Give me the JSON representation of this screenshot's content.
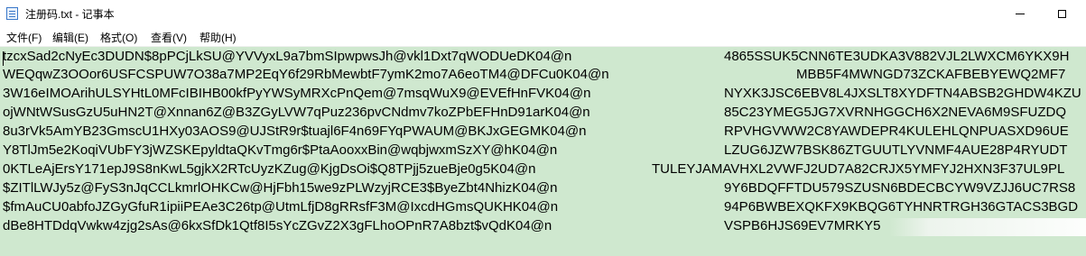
{
  "window": {
    "title": "注册码.txt - 记事本",
    "icon": "notepad-icon"
  },
  "menu": {
    "items": [
      {
        "label": "文件(F)"
      },
      {
        "label": "编辑(E)"
      },
      {
        "label": "格式(O)"
      },
      {
        "label": "查看(V)"
      },
      {
        "label": "帮助(H)"
      }
    ]
  },
  "editor": {
    "background": "#cfe8cf",
    "lines": [
      {
        "left": "tzcxSad2cNyEc3DUDN$8pPCjLkSU@YVVyxL9a7bmSIpwpwsJh@vkl1Dxt7qWODUeDK04@n",
        "right": "4865SSUK5CNN6TE3UDKA3V882VJL2LWXCM6YKX9H"
      },
      {
        "left": "WEQqwZ3OOor6USFCSPUW7O38a7MP2EqY6f29RbMewbtF7ymK2mo7A6eoTM4@DFCu0K04@n",
        "right": "MBB5F4MWNGD73ZCKAFBEBYEWQ2MF7"
      },
      {
        "left": "3W16eIMOArihULSYHtL0MFcIBIHB00kfPyYWSyMRXcPnQem@7msqWuX9@EVEfHnFVK04@n",
        "right": "NYXK3JSC6EBV8L4JXSLT8XYDFTN4ABSB2GHDW4KZU"
      },
      {
        "left": "ojWNtWSusGzU5uHN2T@Xnnan6Z@B3ZGyLVW7qPuz236pvCNdmv7koZPbEFHnD91arK04@n",
        "right": "85C23YMEG5JG7XVRNHGGCH6X2NEVA6M9SFUZDQ"
      },
      {
        "left": "8u3rVk5AmYB23GmscU1HXy03AOS9@UJStR9r$tuajl6F4n69FYqPWAUM@BKJxGEGMK04@n",
        "right": "RPVHGVWW2C8YAWDEPR4KULEHLQNPUASXD96UE"
      },
      {
        "left": "Y8TlJm5e2KoqiVUbFY3jWZSKEpyldtaQKvTmg6r$PtaAooxxBin@wqbjwxmSzXY@hK04@n",
        "right": "LZUG6JZW7BSK86ZTGUUTLYVNMF4AUE28P4RYUDT"
      },
      {
        "left": "0KTLeAjErsY171epJ9S8nKwL5gjkX2RTcUyzKZug@KjgDsOi$Q8TPjj5zueBje0g5K04@n",
        "right": "TULEYJAMAVHXL2VWFJ2UD7A82CRJX5YMFYJ2HXN3F37UL9PL"
      },
      {
        "left": "$ZITlLWJy5z@FyS3nJqCCLkmrlOHKCw@HjFbh15we9zPLWzyjRCE3$ByeZbt4NhizK04@n",
        "right": "9Y6BDQFFTDU579SZUSN6BDECBCYW9VZJJ6UC7RS8"
      },
      {
        "left": "$fmAuCU0abfoJZGyGfuR1ipiiPEAe3C26tp@UtmLfjD8gRRsfF3M@IxcdHGmsQUKHK04@n",
        "right": "94P6BWBEXQKFX9KBQG6TYHNRTRGH36GTACS3BGD"
      },
      {
        "left": "dBe8HTDdqVwkw4zjg2sAs@6kxSfDk1Qtf8I5sYcZGvZ2X3gFLhoOPnR7A8bzt$vQdK04@n",
        "right": "VSPB6HJS69EV7MRKY5"
      }
    ]
  }
}
